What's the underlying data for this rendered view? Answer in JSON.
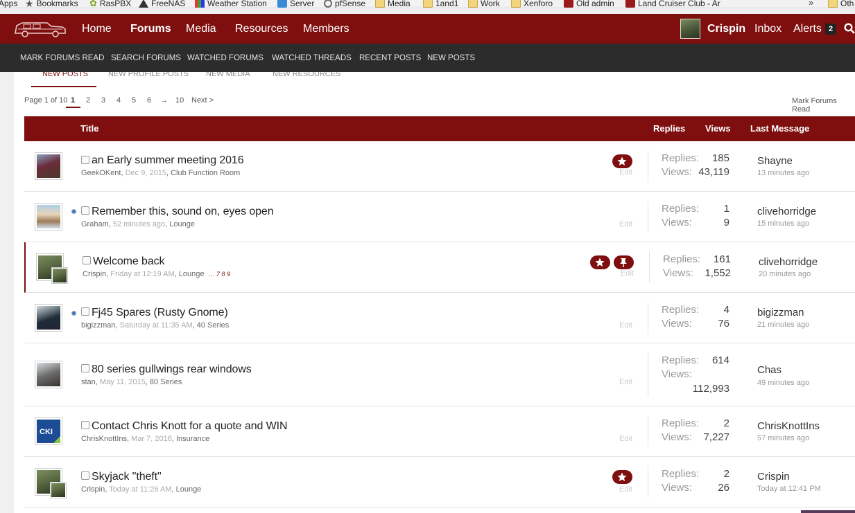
{
  "bookmarks": {
    "items": [
      "Apps",
      "Bookmarks",
      "RasPBX",
      "FreeNAS",
      "Weather Station",
      "Server",
      "pfSense",
      "Media",
      "1and1",
      "Work",
      "Xenforo",
      "Old admin",
      "Land Cruiser Club - Ar",
      "Oth"
    ],
    "more": "»"
  },
  "header": {
    "nav": [
      "Home",
      "Forums",
      "Media",
      "Resources",
      "Members"
    ],
    "user": "Crispin",
    "inbox": "Inbox",
    "alerts": "Alerts",
    "alerts_count": "2"
  },
  "subnav": [
    "MARK FORUMS READ",
    "SEARCH FORUMS",
    "WATCHED FORUMS",
    "WATCHED THREADS",
    "RECENT POSTS",
    "NEW POSTS"
  ],
  "tabs": [
    "NEW POSTS",
    "NEW PROFILE POSTS",
    "NEW MEDIA",
    "NEW RESOURCES"
  ],
  "pager": {
    "label": "Page 1 of 10",
    "pages": [
      "1",
      "2",
      "3",
      "4",
      "5",
      "6"
    ],
    "arrow": "→",
    "last": "10",
    "next": "Next >"
  },
  "mark_read": "Mark Forums Read",
  "columns": {
    "title": "Title",
    "replies": "Replies",
    "views": "Views",
    "last": "Last Message"
  },
  "labels": {
    "replies": "Replies:",
    "views": "Views:",
    "edit": "Edit"
  },
  "threads": [
    {
      "title": "an Early summer meeting 2016",
      "author": "GeekOKent",
      "date": "Dec 9, 2015",
      "forum": "Club Function Room",
      "replies": "185",
      "views": "43,119",
      "last_user": "Shayne",
      "last_time": "13 minutes ago"
    },
    {
      "title": "Remember this, sound on, eyes open",
      "author": "Graham",
      "date": "52 minutes ago",
      "forum": "Lounge",
      "replies": "1",
      "views": "9",
      "last_user": "clivehorridge",
      "last_time": "15 minutes ago"
    },
    {
      "title": "Welcome back",
      "author": "Crispin",
      "date": "Friday at 12:19 AM",
      "forum": "Lounge",
      "pages": "…  7  8  9",
      "replies": "161",
      "views": "1,552",
      "last_user": "clivehorridge",
      "last_time": "20 minutes ago"
    },
    {
      "title": "Fj45 Spares (Rusty Gnome)",
      "author": "bigizzman",
      "date": "Saturday at 11:35 AM",
      "forum": "40 Series",
      "replies": "4",
      "views": "76",
      "last_user": "bigizzman",
      "last_time": "21 minutes ago"
    },
    {
      "title": "80 series gullwings rear windows",
      "author": "stan",
      "date": "May 11, 2015",
      "forum": "80 Series",
      "replies": "614",
      "views": "112,993",
      "last_user": "Chas",
      "last_time": "49 minutes ago"
    },
    {
      "title": "Contact Chris Knott for a quote and WIN",
      "author": "ChrisKnottIns",
      "date": "Mar 7, 2016",
      "forum": "Insurance",
      "replies": "2",
      "views": "7,227",
      "last_user": "ChrisKnottIns",
      "last_time": "57 minutes ago",
      "avatar_text": "CKI"
    },
    {
      "title": "Skyjack \"theft\"",
      "author": "Crispin",
      "date": "Today at 11:26 AM",
      "forum": "Lounge",
      "replies": "2",
      "views": "26",
      "last_user": "Crispin",
      "last_time": "Today at 12:41 PM"
    }
  ],
  "colors": {
    "brand": "#7f0f0f",
    "subnav": "#2c2c2c"
  }
}
